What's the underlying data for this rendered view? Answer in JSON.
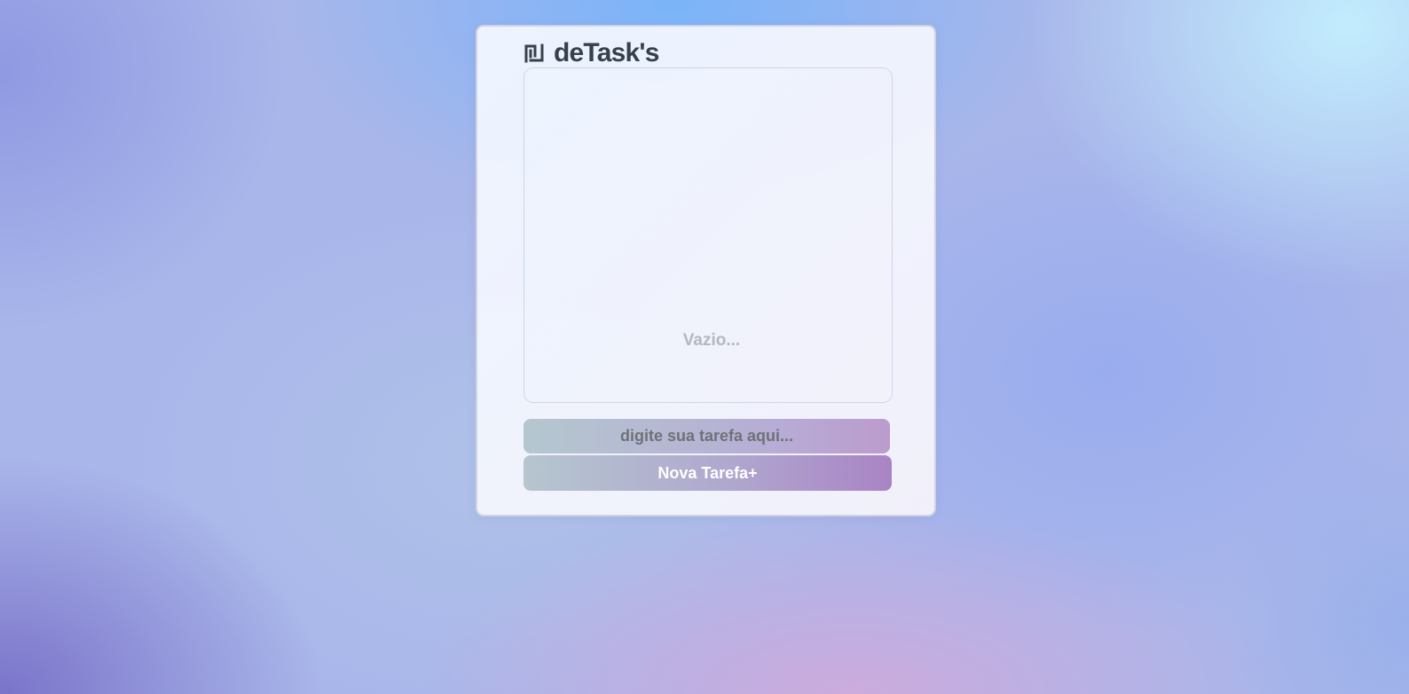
{
  "app": {
    "title": "deTask's",
    "logo_icon": "shekel-icon"
  },
  "task_list": {
    "items": [],
    "empty_text": "Vazio..."
  },
  "new_task": {
    "input_value": "",
    "input_placeholder": "digite sua tarefa aqui...",
    "button_label": "Nova Tarefa+"
  },
  "colors": {
    "title_text": "#36414b",
    "button_gradient_start": "#b5c6cf",
    "button_gradient_end": "#a984c5",
    "empty_text": "#b3b7c0"
  }
}
